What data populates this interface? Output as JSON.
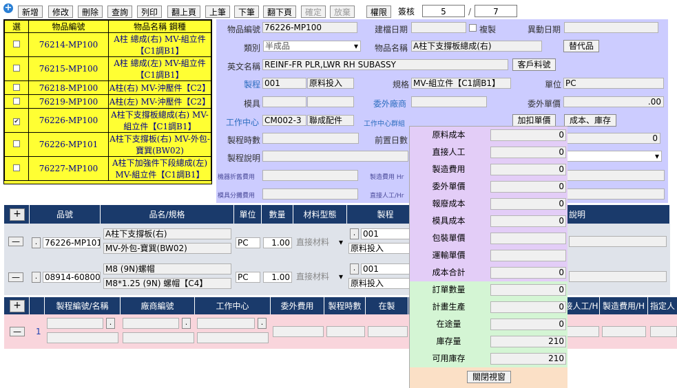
{
  "toolbar": {
    "buttons": [
      "新增",
      "修改",
      "刪除",
      "查詢",
      "列印",
      "翻上頁",
      "上筆",
      "下筆",
      "翻下頁",
      "確定",
      "放棄",
      "權限"
    ],
    "page_label": "簽核",
    "current": "5",
    "slash": "/",
    "total": "7"
  },
  "list": {
    "headers": [
      "選",
      "物品編號",
      "物品名稱 鋼種"
    ],
    "rows": [
      {
        "checked": "",
        "code": "76214-MP100",
        "name": "A柱 總成(右) MV-組立件【C1調B1】"
      },
      {
        "checked": "",
        "code": "76215-MP100",
        "name": "A柱 總成(左) MV-組立件【C1調B1】"
      },
      {
        "checked": "",
        "code": "76218-MP100",
        "name": "A柱(右) MV-沖壓件【C2】"
      },
      {
        "checked": "",
        "code": "76219-MP100",
        "name": "A柱(左) MV-沖壓件【C2】"
      },
      {
        "checked": "✔",
        "code": "76226-MP100",
        "name": "A柱下支撐板總成(右) MV-組立件【C1調B1】"
      },
      {
        "checked": "",
        "code": "76226-MP101",
        "name": "A柱下支撐板(右) MV-外包-寶巽(BW02)"
      },
      {
        "checked": "",
        "code": "76227-MP100",
        "name": "A柱下加強件下段總成(左) MV-組立件【C1調B1】"
      }
    ]
  },
  "form": {
    "item_code_label": "物品編號",
    "item_code": "76226-MP100",
    "created_label": "建檔日期",
    "copy_label": "複製",
    "changed_label": "異動日期",
    "type_label": "類別",
    "type_value": "半成品",
    "item_name_label": "物品名稱",
    "item_name": "A柱下支撐板總成(右)",
    "substitute_btn": "替代品",
    "en_name_label": "英文名稱",
    "en_name": "REINF-FR PLR,LWR RH SUBASSY",
    "customer_btn": "客戶料號",
    "process_label": "製程",
    "process_code": "001",
    "process_name": "原料投入",
    "spec_label": "規格",
    "spec": "MV-組立件【C1調B1】",
    "unit_label": "單位",
    "unit": "PC",
    "mold_label": "模具",
    "vendor_label": "委外廠商",
    "outsource_price_label": "委外單價",
    "outsource_price": ".00",
    "workcenter_label": "工作中心",
    "workcenter_code": "CM002-3",
    "workcenter_name": "聯成配件",
    "wc_group_label": "工作中心群組",
    "markup_btn": "加扣單價",
    "cost_stock_btn": "成本、庫存",
    "hours_label": "製程時數",
    "lead_label": "前置日數",
    "lead_value": "0",
    "desc_label": "製程說明",
    "depr_label": "機器折舊費用",
    "mfg_hr_label": "製造費用 Hr",
    "mold_share_label": "模具分攤費用",
    "labor_hr_label": "直接人工/Hr"
  },
  "bom": {
    "headers": [
      "品號",
      "品名/規格",
      "單位",
      "數量",
      "材料型態",
      "製程",
      "說明"
    ],
    "rows": [
      {
        "code": "76226-MP101",
        "name": "A柱下支撐板(右)",
        "spec": "MV-外包-寶巽(BW02)",
        "unit": "PC",
        "qty": "1.00",
        "type": "直接材料",
        "proc": "001",
        "proc_name": "原料投入"
      },
      {
        "code": "08914-60800",
        "name": "M8 (9N)螺帽",
        "spec": "M8*1.25 (9N) 螺帽【C4】",
        "unit": "PC",
        "qty": "1.00",
        "type": "直接材料",
        "proc": "001",
        "proc_name": "原料投入"
      }
    ]
  },
  "routing": {
    "headers": [
      "製程編號/名稱",
      "廠商編號",
      "工作中心",
      "委外費用",
      "製程時數",
      "在製",
      "直接人工/H",
      "製造費用/H",
      "指定人"
    ],
    "row_no": "1"
  },
  "popup": {
    "rows": [
      {
        "label": "原料成本",
        "value": "0",
        "kind": "cost"
      },
      {
        "label": "直接人工",
        "value": "0",
        "kind": "cost"
      },
      {
        "label": "製造費用",
        "value": "0",
        "kind": "cost"
      },
      {
        "label": "委外單價",
        "value": "0",
        "kind": "cost"
      },
      {
        "label": "報廢成本",
        "value": "0",
        "kind": "cost"
      },
      {
        "label": "模具成本",
        "value": "0",
        "kind": "cost"
      },
      {
        "label": "包裝單價",
        "value": "",
        "kind": "cost"
      },
      {
        "label": "運輸單價",
        "value": "",
        "kind": "cost"
      },
      {
        "label": "成本合計",
        "value": "0",
        "kind": "cost"
      },
      {
        "label": "訂單數量",
        "value": "0",
        "kind": "stock"
      },
      {
        "label": "計畫生產",
        "value": "0",
        "kind": "stock"
      },
      {
        "label": "在途量",
        "value": "0",
        "kind": "stock"
      },
      {
        "label": "庫存量",
        "value": "210",
        "kind": "stock"
      },
      {
        "label": "可用庫存",
        "value": "210",
        "kind": "stock"
      }
    ],
    "close_btn": "關閉視窗",
    "colors": {
      "cost": "#e3cdf7",
      "stock": "#d4f5d4",
      "footer": "#fbe0c6"
    }
  }
}
